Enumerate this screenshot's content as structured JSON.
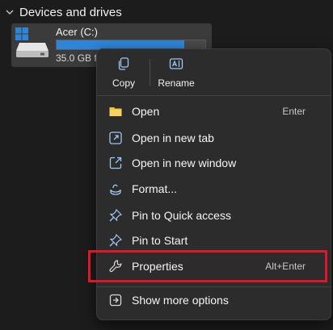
{
  "section": {
    "title": "Devices and drives"
  },
  "drive": {
    "name": "Acer (C:)",
    "size_text": "35.0 GB fr",
    "used_fraction": 0.86
  },
  "context_menu": {
    "quick_actions": [
      {
        "label": "Copy",
        "icon": "copy-icon"
      },
      {
        "label": "Rename",
        "icon": "rename-icon"
      }
    ],
    "items": [
      {
        "label": "Open",
        "shortcut": "Enter",
        "icon": "folder-icon"
      },
      {
        "label": "Open in new tab",
        "shortcut": "",
        "icon": "new-tab-icon"
      },
      {
        "label": "Open in new window",
        "shortcut": "",
        "icon": "new-window-icon"
      },
      {
        "label": "Format...",
        "shortcut": "",
        "icon": "format-icon"
      },
      {
        "label": "Pin to Quick access",
        "shortcut": "",
        "icon": "pin-icon"
      },
      {
        "label": "Pin to Start",
        "shortcut": "",
        "icon": "pin-icon"
      },
      {
        "label": "Properties",
        "shortcut": "Alt+Enter",
        "icon": "wrench-icon"
      },
      {
        "label": "Show more options",
        "shortcut": "",
        "icon": "more-options-icon"
      }
    ]
  },
  "colors": {
    "accent": "#2f86d9",
    "highlight": "#e0172b",
    "menu_bg": "#2c2c2c",
    "page_bg": "#1c1c1c",
    "folder_yellow": "#f3c13a"
  }
}
